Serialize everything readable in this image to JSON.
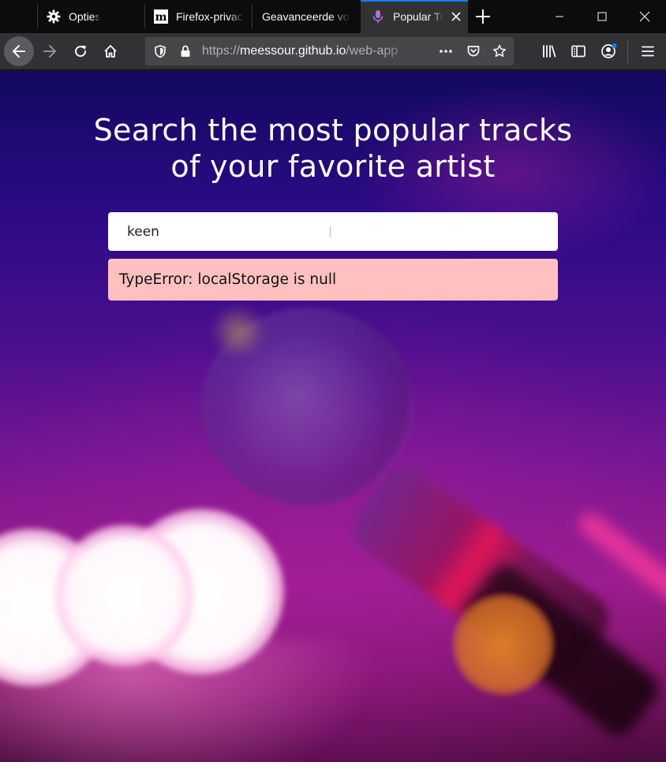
{
  "browser": {
    "tabs": [
      {
        "label": "Opties",
        "icon": "gear-icon",
        "active": false
      },
      {
        "label": "Firefox-privacy",
        "icon": "m-logo-icon",
        "active": false
      },
      {
        "label": "Geavanceerde voo",
        "icon": "",
        "active": false
      },
      {
        "label": "Popular Tr",
        "icon": "microphone-icon",
        "active": true
      }
    ],
    "url": {
      "scheme": "https://",
      "host": "meessour.github.io",
      "path": "/web-app"
    },
    "colors": {
      "tab_accent": "#0a84ff",
      "toolbar": "#323234",
      "tabstrip": "#0c0c0d"
    }
  },
  "page": {
    "headline": "Search the most popular tracks of your favorite artist",
    "search": {
      "value": "keen",
      "placeholder": ""
    },
    "error": "TypeError: localStorage is null",
    "colors": {
      "error_bg": "#ffc0c0",
      "text": "#ffffff"
    }
  }
}
